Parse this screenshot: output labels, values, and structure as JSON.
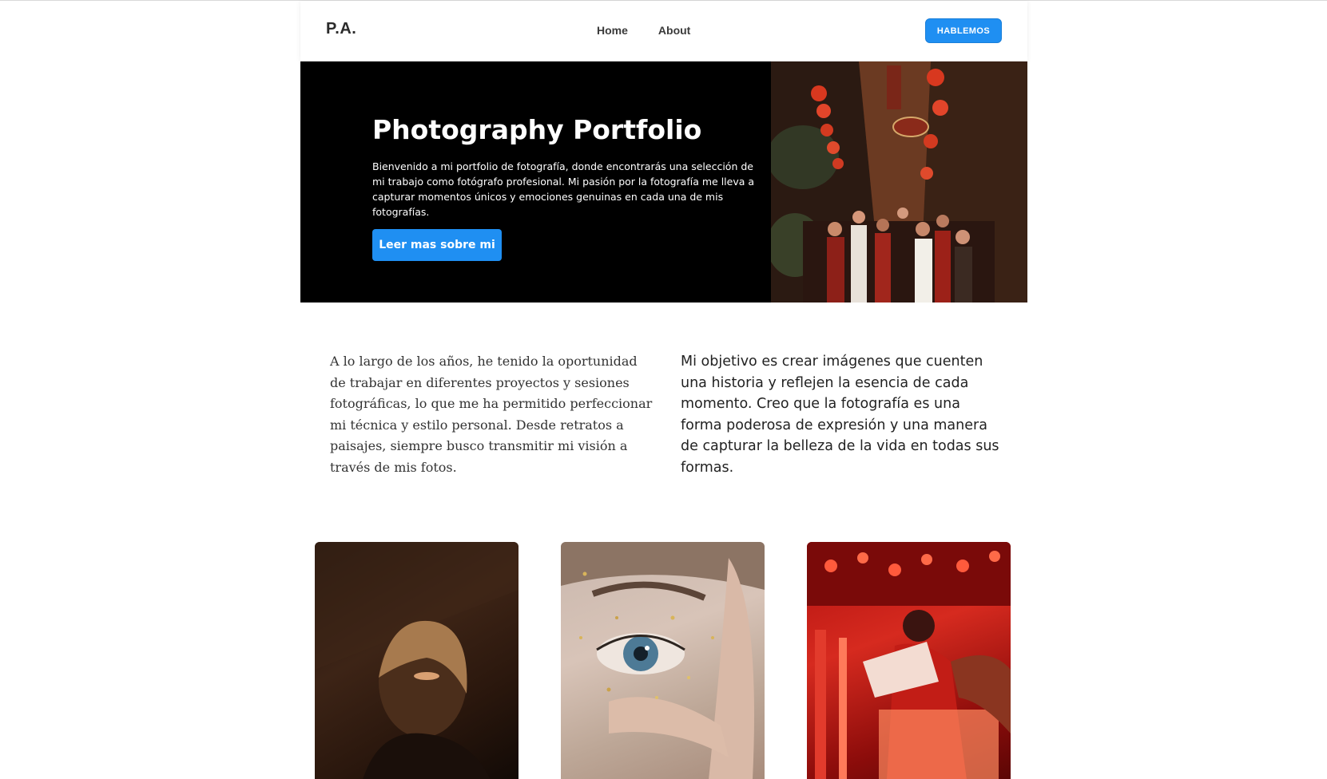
{
  "nav": {
    "logo": "P.A.",
    "links": [
      {
        "label": "Home"
      },
      {
        "label": "About"
      }
    ],
    "cta_label": "HABLEMOS"
  },
  "hero": {
    "title": "Photography Portfolio",
    "text": "Bienvenido a mi portfolio de fotografía, donde encontrarás una selección de mi trabajo como fotógrafo profesional. Mi pasión por la fotografía me lleva a capturar momentos únicos y emociones genuinas en cada una de mis fotografías.",
    "button_label": "Leer mas sobre mi"
  },
  "about": {
    "left": "A lo largo de los años, he tenido la oportunidad de trabajar en diferentes proyectos y sesiones fotográficas, lo que me ha permitido perfeccionar mi técnica y estilo personal. Desde retratos a paisajes, siempre busco transmitir mi visión a través de mis fotos.",
    "right": "Mi objetivo es crear imágenes que cuenten una historia y reflejen la esencia de cada momento. Creo que la fotografía es una forma poderosa de expresión y una manera de capturar la belleza de la vida en todas sus formas."
  },
  "colors": {
    "accent": "#1f8ff2",
    "hero_bg": "#000000",
    "text_dark": "#222222"
  }
}
